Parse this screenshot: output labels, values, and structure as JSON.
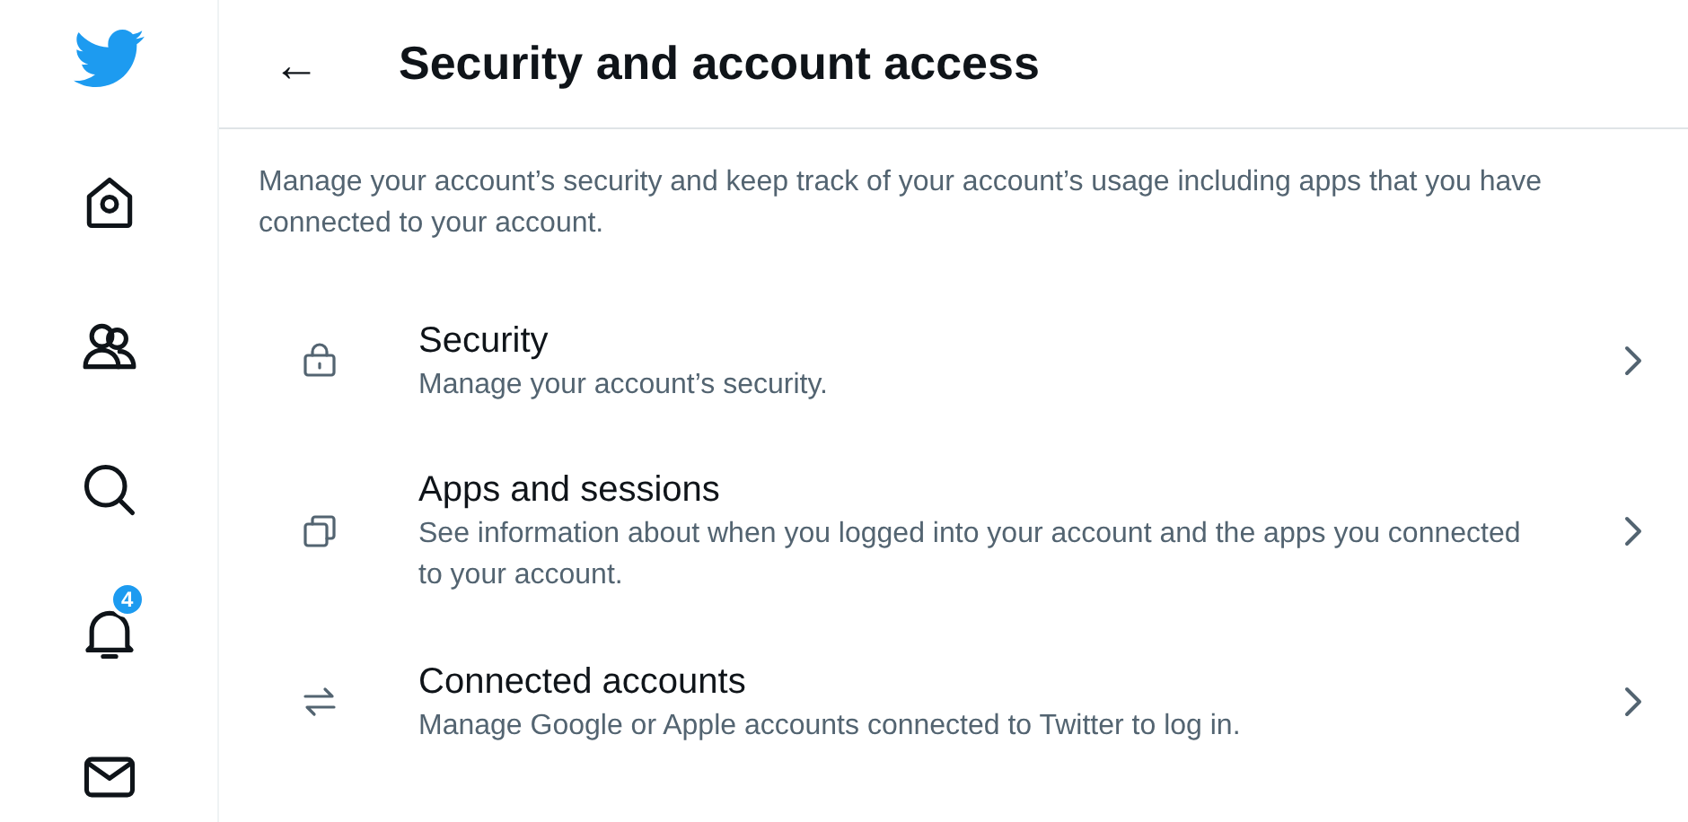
{
  "sidebar": {
    "items": [
      {
        "kind": "logo"
      },
      {
        "kind": "home"
      },
      {
        "kind": "communities"
      },
      {
        "kind": "search"
      },
      {
        "kind": "notifications",
        "badge": "4"
      },
      {
        "kind": "messages"
      }
    ]
  },
  "header": {
    "back": "←",
    "title": "Security and account access"
  },
  "description": "Manage your account’s security and keep track of your account’s usage including apps that you have connected to your account.",
  "items": [
    {
      "kind": "lock",
      "title": "Security",
      "subtitle": "Manage your account’s security."
    },
    {
      "kind": "copy",
      "title": "Apps and sessions",
      "subtitle": "See information about when you logged into your account and the apps you connected to your account."
    },
    {
      "kind": "arrows",
      "title": "Connected accounts",
      "subtitle": "Manage Google or Apple accounts connected to Twitter to log in."
    }
  ]
}
